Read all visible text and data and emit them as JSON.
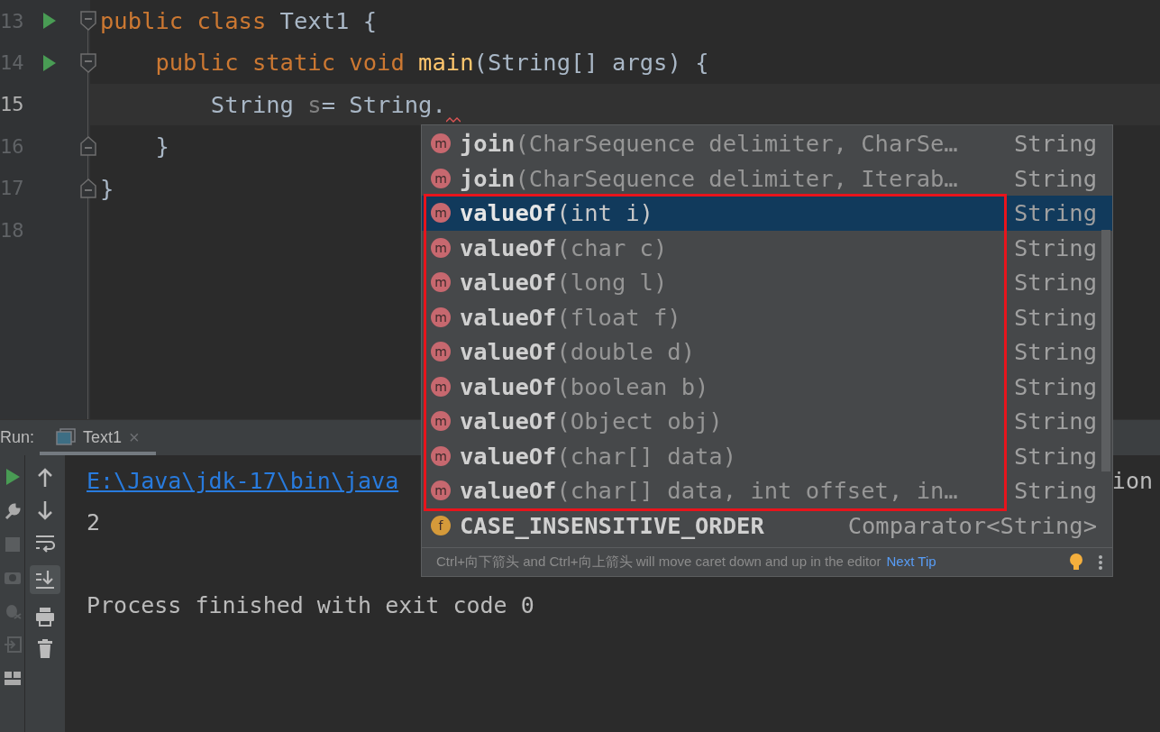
{
  "editor": {
    "lines": [
      {
        "number": "13",
        "run": true,
        "fold_start": true,
        "fold_end": false,
        "current": false,
        "error": false,
        "tokens": [
          {
            "kind": "keyword",
            "text": "public class "
          },
          {
            "kind": "plain",
            "text": "Text1 {"
          }
        ]
      },
      {
        "number": "14",
        "run": true,
        "fold_start": true,
        "fold_end": false,
        "current": false,
        "error": false,
        "tokens": [
          {
            "kind": "keyword",
            "text": "    public static void "
          },
          {
            "kind": "method",
            "text": "main"
          },
          {
            "kind": "plain",
            "text": "(String[] args) {"
          }
        ]
      },
      {
        "number": "15",
        "run": false,
        "fold_start": false,
        "fold_end": false,
        "current": true,
        "error": true,
        "tokens": [
          {
            "kind": "plain",
            "text": "        String "
          },
          {
            "kind": "unused",
            "text": "s"
          },
          {
            "kind": "plain",
            "text": "= String."
          }
        ]
      },
      {
        "number": "16",
        "run": false,
        "fold_start": false,
        "fold_end": true,
        "current": false,
        "error": false,
        "tokens": [
          {
            "kind": "plain",
            "text": "    }"
          }
        ]
      },
      {
        "number": "17",
        "run": false,
        "fold_start": false,
        "fold_end": true,
        "current": false,
        "error": false,
        "tokens": [
          {
            "kind": "plain",
            "text": "}"
          }
        ]
      },
      {
        "number": "18",
        "run": false,
        "fold_start": false,
        "fold_end": false,
        "current": false,
        "error": false
      }
    ]
  },
  "run_panel": {
    "label": "Run:",
    "tabs": [
      {
        "title": "Text1",
        "close": "×",
        "selected": true
      }
    ],
    "scroll_to_end": true,
    "console": [
      {
        "kind": "link",
        "text": "E:\\Java\\jdk-17\\bin\\java",
        "tail": "ion"
      },
      {
        "kind": "output",
        "text": "2"
      },
      {
        "kind": "exit",
        "text": "Process finished with exit code 0"
      }
    ]
  },
  "completion_popup": {
    "items": [
      {
        "kind": "method",
        "icon": "m",
        "name": "join",
        "params": "(CharSequence delimiter, CharSe…",
        "type": "String",
        "selected": false
      },
      {
        "kind": "method",
        "icon": "m",
        "name": "join",
        "params": "(CharSequence delimiter, Iterab…",
        "type": "String",
        "selected": false
      },
      {
        "kind": "method",
        "icon": "m",
        "name": "valueOf",
        "params": "(int i)",
        "type": "String",
        "selected": true
      },
      {
        "kind": "method",
        "icon": "m",
        "name": "valueOf",
        "params": "(char c)",
        "type": "String",
        "selected": false
      },
      {
        "kind": "method",
        "icon": "m",
        "name": "valueOf",
        "params": "(long l)",
        "type": "String",
        "selected": false
      },
      {
        "kind": "method",
        "icon": "m",
        "name": "valueOf",
        "params": "(float f)",
        "type": "String",
        "selected": false
      },
      {
        "kind": "method",
        "icon": "m",
        "name": "valueOf",
        "params": "(double d)",
        "type": "String",
        "selected": false
      },
      {
        "kind": "method",
        "icon": "m",
        "name": "valueOf",
        "params": "(boolean b)",
        "type": "String",
        "selected": false
      },
      {
        "kind": "method",
        "icon": "m",
        "name": "valueOf",
        "params": "(Object obj)",
        "type": "String",
        "selected": false
      },
      {
        "kind": "method",
        "icon": "m",
        "name": "valueOf",
        "params": "(char[] data)",
        "type": "String",
        "selected": false
      },
      {
        "kind": "method",
        "icon": "m",
        "name": "valueOf",
        "params": "(char[] data, int offset, in…",
        "type": "String",
        "selected": false
      },
      {
        "kind": "field",
        "icon": "f",
        "name": "CASE_INSENSITIVE_ORDER",
        "type": "Comparator<String>",
        "selected": false
      }
    ],
    "hint": "Ctrl+向下箭头 and Ctrl+向上箭头 will move caret down and up in the editor",
    "hint_link": "Next Tip"
  }
}
